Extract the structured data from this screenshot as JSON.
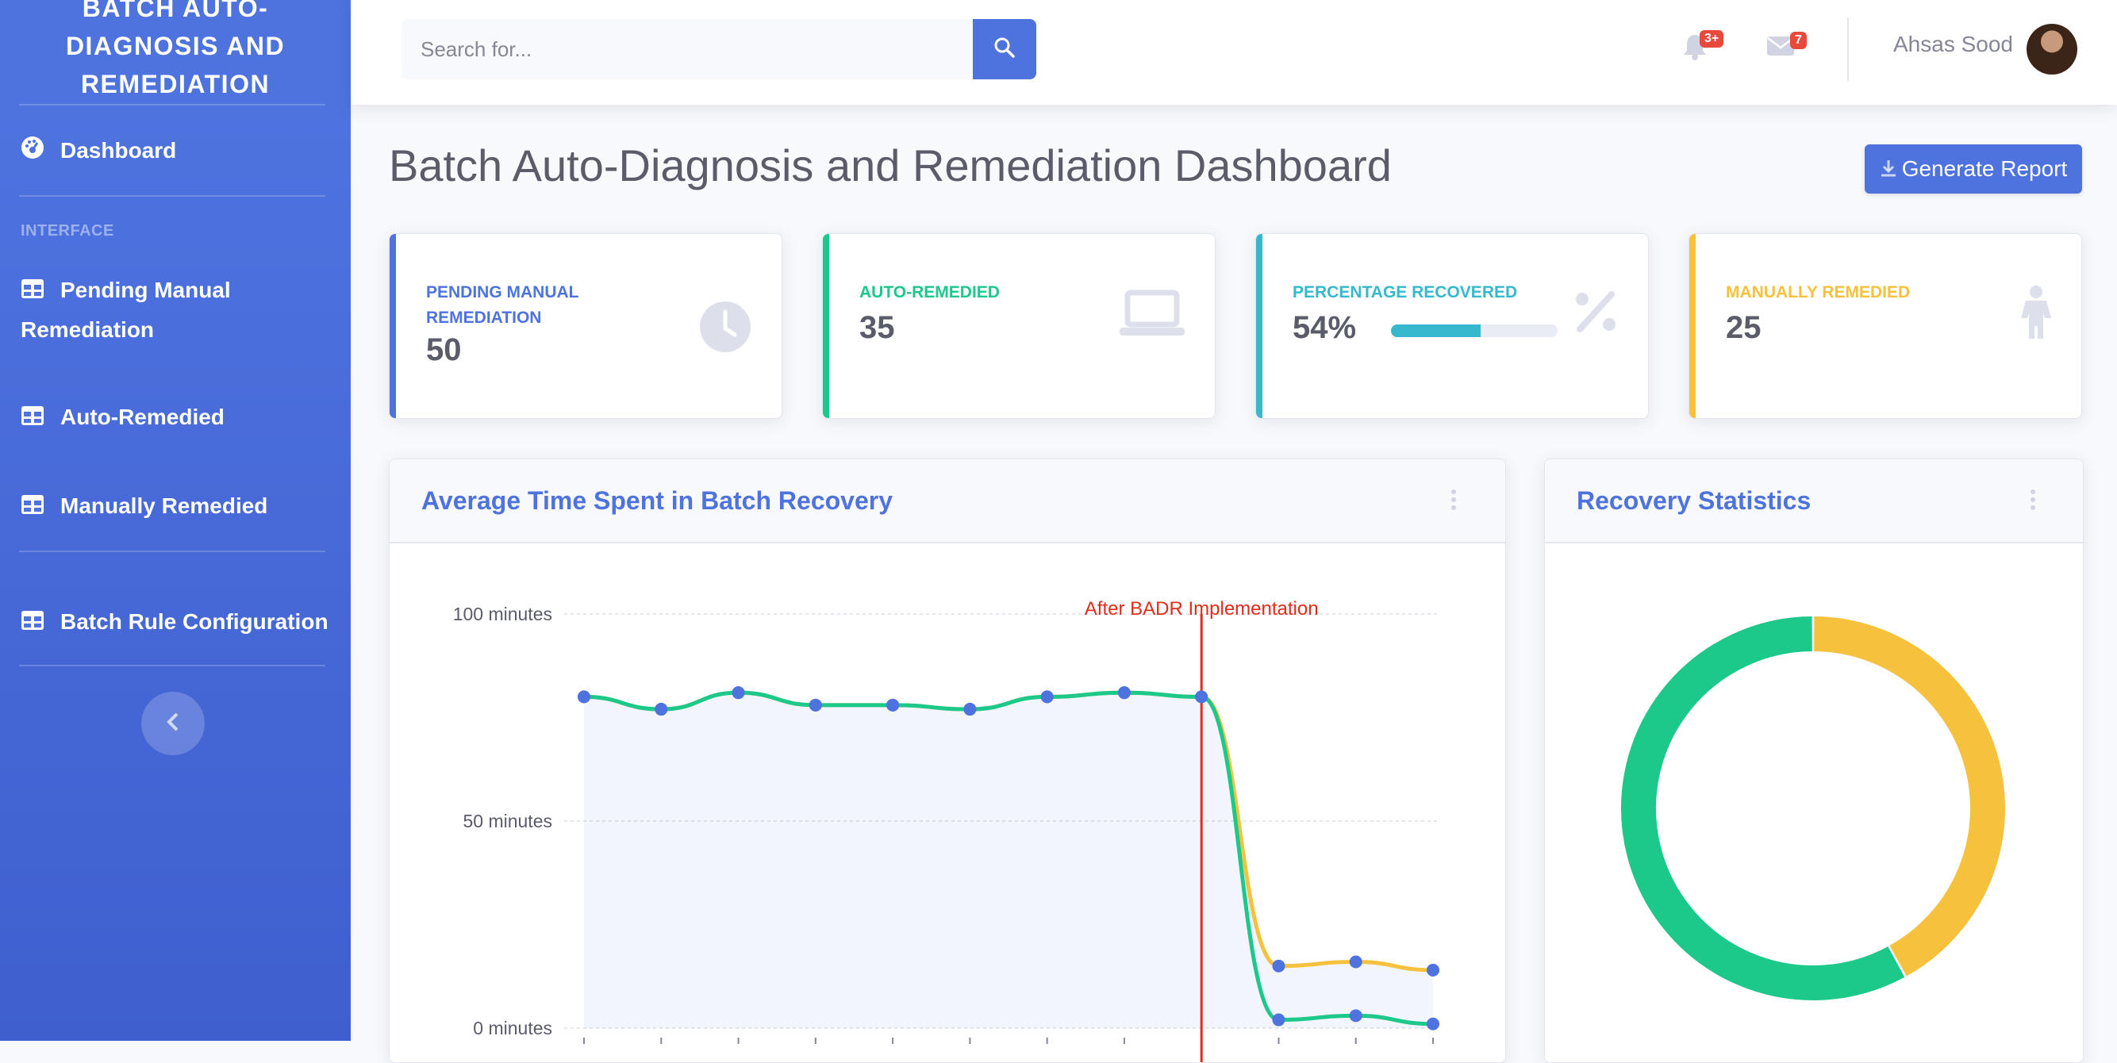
{
  "sidebar": {
    "brand_lines": [
      "BATCH AUTO-",
      "DIAGNOSIS AND",
      "REMEDIATION"
    ],
    "dashboard": "Dashboard",
    "heading": "INTERFACE",
    "pending": "Pending Manual Remediation",
    "auto": "Auto-Remedied",
    "manual": "Manually Remedied",
    "rules": "Batch Rule Configuration"
  },
  "topbar": {
    "search_placeholder": "Search for...",
    "alerts_badge": "3+",
    "messages_badge": "7",
    "user_name": "Ahsas Sood"
  },
  "page": {
    "title": "Batch Auto-Diagnosis and Remediation Dashboard",
    "report_button": "Generate Report"
  },
  "cards": {
    "pending": {
      "label": "PENDING MANUAL REMEDIATION",
      "value": "50",
      "color": "#4e73df",
      "icon": "clock-icon"
    },
    "auto": {
      "label": "AUTO-REMEDIED",
      "value": "35",
      "color": "#1cc88a",
      "icon": "laptop-icon"
    },
    "percent": {
      "label": "PERCENTAGE RECOVERED",
      "value": "54%",
      "progress": 0.54,
      "color": "#36b9cc",
      "icon": "percent-icon"
    },
    "manual": {
      "label": "MANUALLY REMEDIED",
      "value": "25",
      "color": "#f6c23e",
      "icon": "child-icon"
    }
  },
  "panels": {
    "line_title": "Average Time Spent in Batch Recovery",
    "donut_title": "Recovery Statistics"
  },
  "chart_data": [
    {
      "type": "line",
      "title": "Average Time Spent in Batch Recovery",
      "yticks": [
        "100 minutes",
        "50 minutes",
        "0 minutes"
      ],
      "ylim": [
        0,
        100
      ],
      "annotation": "After BADR Implementation",
      "annotation_index": 8,
      "grid": true,
      "series": [
        {
          "color": "#f6c23e",
          "values": [
            80,
            77,
            81,
            78,
            78,
            77,
            80,
            81,
            80,
            15,
            16,
            14
          ]
        },
        {
          "color": "#1cc88a",
          "values": [
            80,
            77,
            81,
            78,
            78,
            77,
            80,
            81,
            80,
            2,
            3,
            1
          ]
        }
      ],
      "point_color": "#4e73df"
    },
    {
      "type": "pie",
      "title": "Recovery Statistics",
      "values": [
        58,
        42
      ],
      "colors": [
        "#1cc88a",
        "#f6c23e"
      ]
    }
  ]
}
